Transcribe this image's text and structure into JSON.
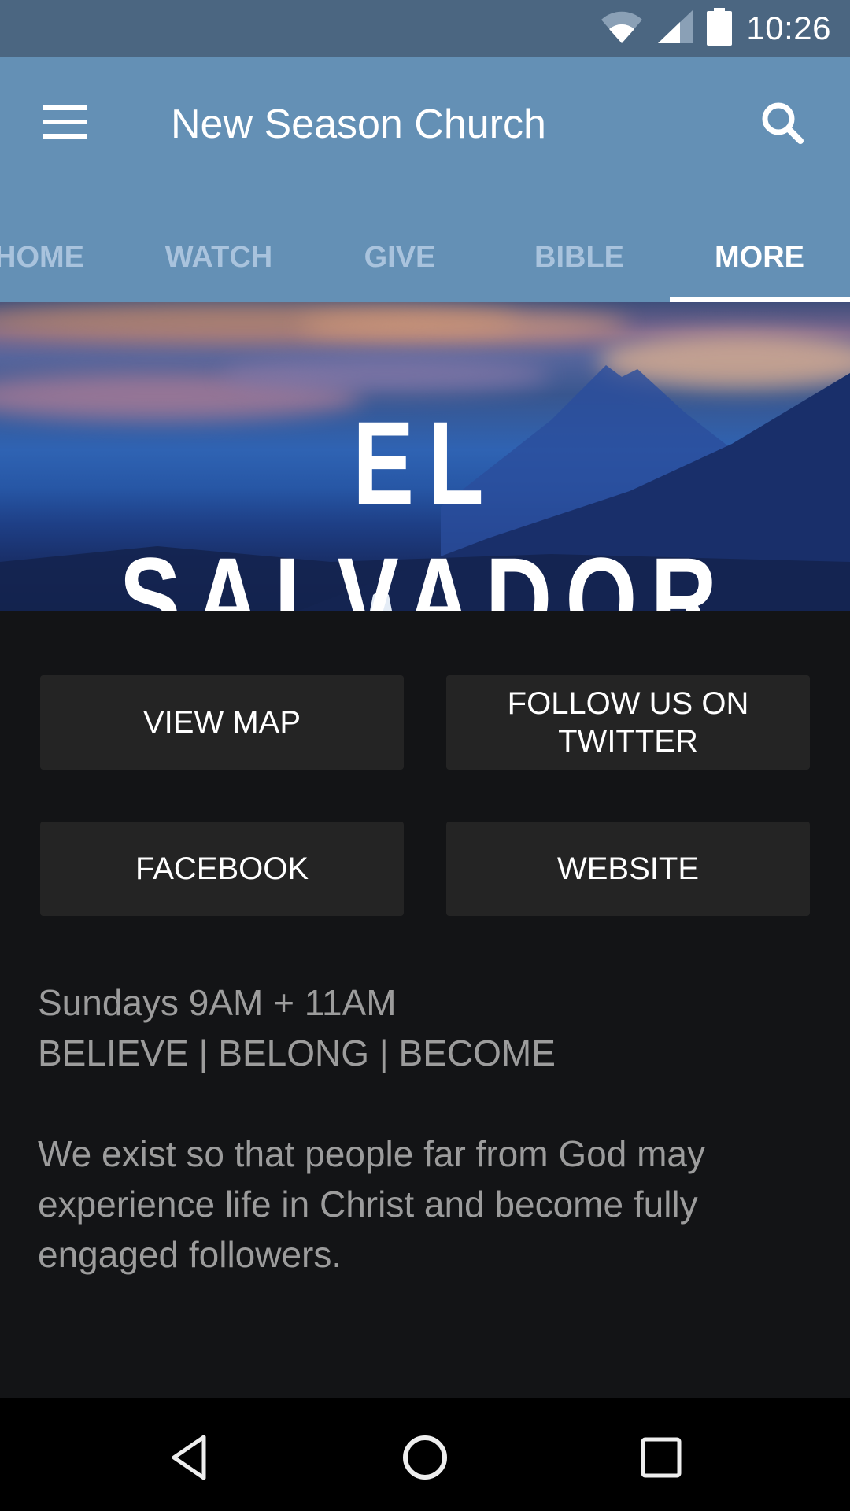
{
  "status_bar": {
    "time": "10:26",
    "icons": [
      "wifi-icon",
      "cell-signal-icon",
      "battery-icon"
    ]
  },
  "app_bar": {
    "title": "New Season Church",
    "menu_icon": "hamburger-menu-icon",
    "search_icon": "search-icon"
  },
  "tabs": [
    {
      "label": "HOME",
      "active": false
    },
    {
      "label": "WATCH",
      "active": false
    },
    {
      "label": "GIVE",
      "active": false
    },
    {
      "label": "BIBLE",
      "active": false
    },
    {
      "label": "MORE",
      "active": true
    }
  ],
  "banner": {
    "text": "EL SALVADOR"
  },
  "buttons": {
    "view_map": "VIEW MAP",
    "twitter_line1": "FOLLOW US ON",
    "twitter_line2": "TWITTER",
    "facebook": "FACEBOOK",
    "website": "WEBSITE"
  },
  "info": {
    "schedule": "Sundays 9AM + 11AM",
    "motto": "BELIEVE | BELONG | BECOME",
    "mission_line1": "We exist so that people far from God may",
    "mission_line2": "experience life in Christ and become fully",
    "mission_line3": "engaged followers."
  },
  "nav_bar": {
    "back_icon": "back-icon",
    "home_icon": "home-icon",
    "recents_icon": "recents-icon"
  },
  "colors": {
    "status_bar": "#4b6681",
    "app_bar": "#6490b5",
    "tab_inactive": "#a9c3dd",
    "background": "#131416",
    "button": "#242424",
    "body_text": "#9c9c9c"
  }
}
